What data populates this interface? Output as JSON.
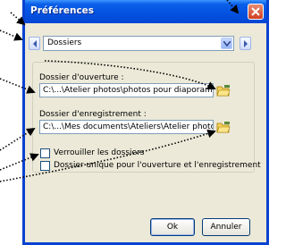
{
  "window": {
    "title": "Préférences",
    "close_icon": "close-icon"
  },
  "nav": {
    "prev_icon": "arrow-left-icon",
    "next_icon": "arrow-right-icon",
    "combo_value": "Dossiers"
  },
  "open_folder": {
    "label": "Dossier d'ouverture :",
    "value": "C:\\...\\Atelier photos\\photos pour diaporama\\",
    "browse_icon": "browse-folder-icon"
  },
  "save_folder": {
    "label": "Dossier d'enregistrement :",
    "value": "C:\\...\\Mes documents\\Ateliers\\Atelier photos\\",
    "browse_icon": "browse-folder-icon"
  },
  "options": [
    {
      "label": "Verrouiller les dossiers",
      "checked": false
    },
    {
      "label": "Dossier unique pour l'ouverture et l'enregistrement",
      "checked": false
    }
  ],
  "buttons": {
    "ok": "Ok",
    "cancel": "Annuler"
  },
  "colors": {
    "titlebar": "#0451e0",
    "window_bg": "#ece9d8",
    "annotation_arrows": "#000000"
  }
}
